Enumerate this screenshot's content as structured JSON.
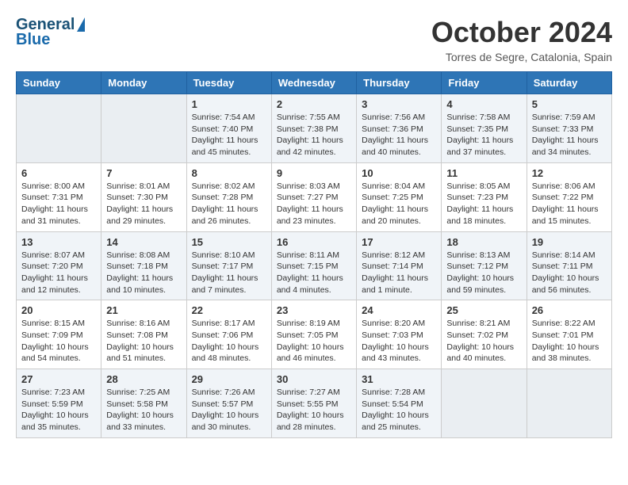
{
  "header": {
    "logo_general": "General",
    "logo_blue": "Blue",
    "month": "October 2024",
    "location": "Torres de Segre, Catalonia, Spain"
  },
  "days_of_week": [
    "Sunday",
    "Monday",
    "Tuesday",
    "Wednesday",
    "Thursday",
    "Friday",
    "Saturday"
  ],
  "weeks": [
    [
      {
        "day": "",
        "sunrise": "",
        "sunset": "",
        "daylight": ""
      },
      {
        "day": "",
        "sunrise": "",
        "sunset": "",
        "daylight": ""
      },
      {
        "day": "1",
        "sunrise": "Sunrise: 7:54 AM",
        "sunset": "Sunset: 7:40 PM",
        "daylight": "Daylight: 11 hours and 45 minutes."
      },
      {
        "day": "2",
        "sunrise": "Sunrise: 7:55 AM",
        "sunset": "Sunset: 7:38 PM",
        "daylight": "Daylight: 11 hours and 42 minutes."
      },
      {
        "day": "3",
        "sunrise": "Sunrise: 7:56 AM",
        "sunset": "Sunset: 7:36 PM",
        "daylight": "Daylight: 11 hours and 40 minutes."
      },
      {
        "day": "4",
        "sunrise": "Sunrise: 7:58 AM",
        "sunset": "Sunset: 7:35 PM",
        "daylight": "Daylight: 11 hours and 37 minutes."
      },
      {
        "day": "5",
        "sunrise": "Sunrise: 7:59 AM",
        "sunset": "Sunset: 7:33 PM",
        "daylight": "Daylight: 11 hours and 34 minutes."
      }
    ],
    [
      {
        "day": "6",
        "sunrise": "Sunrise: 8:00 AM",
        "sunset": "Sunset: 7:31 PM",
        "daylight": "Daylight: 11 hours and 31 minutes."
      },
      {
        "day": "7",
        "sunrise": "Sunrise: 8:01 AM",
        "sunset": "Sunset: 7:30 PM",
        "daylight": "Daylight: 11 hours and 29 minutes."
      },
      {
        "day": "8",
        "sunrise": "Sunrise: 8:02 AM",
        "sunset": "Sunset: 7:28 PM",
        "daylight": "Daylight: 11 hours and 26 minutes."
      },
      {
        "day": "9",
        "sunrise": "Sunrise: 8:03 AM",
        "sunset": "Sunset: 7:27 PM",
        "daylight": "Daylight: 11 hours and 23 minutes."
      },
      {
        "day": "10",
        "sunrise": "Sunrise: 8:04 AM",
        "sunset": "Sunset: 7:25 PM",
        "daylight": "Daylight: 11 hours and 20 minutes."
      },
      {
        "day": "11",
        "sunrise": "Sunrise: 8:05 AM",
        "sunset": "Sunset: 7:23 PM",
        "daylight": "Daylight: 11 hours and 18 minutes."
      },
      {
        "day": "12",
        "sunrise": "Sunrise: 8:06 AM",
        "sunset": "Sunset: 7:22 PM",
        "daylight": "Daylight: 11 hours and 15 minutes."
      }
    ],
    [
      {
        "day": "13",
        "sunrise": "Sunrise: 8:07 AM",
        "sunset": "Sunset: 7:20 PM",
        "daylight": "Daylight: 11 hours and 12 minutes."
      },
      {
        "day": "14",
        "sunrise": "Sunrise: 8:08 AM",
        "sunset": "Sunset: 7:18 PM",
        "daylight": "Daylight: 11 hours and 10 minutes."
      },
      {
        "day": "15",
        "sunrise": "Sunrise: 8:10 AM",
        "sunset": "Sunset: 7:17 PM",
        "daylight": "Daylight: 11 hours and 7 minutes."
      },
      {
        "day": "16",
        "sunrise": "Sunrise: 8:11 AM",
        "sunset": "Sunset: 7:15 PM",
        "daylight": "Daylight: 11 hours and 4 minutes."
      },
      {
        "day": "17",
        "sunrise": "Sunrise: 8:12 AM",
        "sunset": "Sunset: 7:14 PM",
        "daylight": "Daylight: 11 hours and 1 minute."
      },
      {
        "day": "18",
        "sunrise": "Sunrise: 8:13 AM",
        "sunset": "Sunset: 7:12 PM",
        "daylight": "Daylight: 10 hours and 59 minutes."
      },
      {
        "day": "19",
        "sunrise": "Sunrise: 8:14 AM",
        "sunset": "Sunset: 7:11 PM",
        "daylight": "Daylight: 10 hours and 56 minutes."
      }
    ],
    [
      {
        "day": "20",
        "sunrise": "Sunrise: 8:15 AM",
        "sunset": "Sunset: 7:09 PM",
        "daylight": "Daylight: 10 hours and 54 minutes."
      },
      {
        "day": "21",
        "sunrise": "Sunrise: 8:16 AM",
        "sunset": "Sunset: 7:08 PM",
        "daylight": "Daylight: 10 hours and 51 minutes."
      },
      {
        "day": "22",
        "sunrise": "Sunrise: 8:17 AM",
        "sunset": "Sunset: 7:06 PM",
        "daylight": "Daylight: 10 hours and 48 minutes."
      },
      {
        "day": "23",
        "sunrise": "Sunrise: 8:19 AM",
        "sunset": "Sunset: 7:05 PM",
        "daylight": "Daylight: 10 hours and 46 minutes."
      },
      {
        "day": "24",
        "sunrise": "Sunrise: 8:20 AM",
        "sunset": "Sunset: 7:03 PM",
        "daylight": "Daylight: 10 hours and 43 minutes."
      },
      {
        "day": "25",
        "sunrise": "Sunrise: 8:21 AM",
        "sunset": "Sunset: 7:02 PM",
        "daylight": "Daylight: 10 hours and 40 minutes."
      },
      {
        "day": "26",
        "sunrise": "Sunrise: 8:22 AM",
        "sunset": "Sunset: 7:01 PM",
        "daylight": "Daylight: 10 hours and 38 minutes."
      }
    ],
    [
      {
        "day": "27",
        "sunrise": "Sunrise: 7:23 AM",
        "sunset": "Sunset: 5:59 PM",
        "daylight": "Daylight: 10 hours and 35 minutes."
      },
      {
        "day": "28",
        "sunrise": "Sunrise: 7:25 AM",
        "sunset": "Sunset: 5:58 PM",
        "daylight": "Daylight: 10 hours and 33 minutes."
      },
      {
        "day": "29",
        "sunrise": "Sunrise: 7:26 AM",
        "sunset": "Sunset: 5:57 PM",
        "daylight": "Daylight: 10 hours and 30 minutes."
      },
      {
        "day": "30",
        "sunrise": "Sunrise: 7:27 AM",
        "sunset": "Sunset: 5:55 PM",
        "daylight": "Daylight: 10 hours and 28 minutes."
      },
      {
        "day": "31",
        "sunrise": "Sunrise: 7:28 AM",
        "sunset": "Sunset: 5:54 PM",
        "daylight": "Daylight: 10 hours and 25 minutes."
      },
      {
        "day": "",
        "sunrise": "",
        "sunset": "",
        "daylight": ""
      },
      {
        "day": "",
        "sunrise": "",
        "sunset": "",
        "daylight": ""
      }
    ]
  ]
}
